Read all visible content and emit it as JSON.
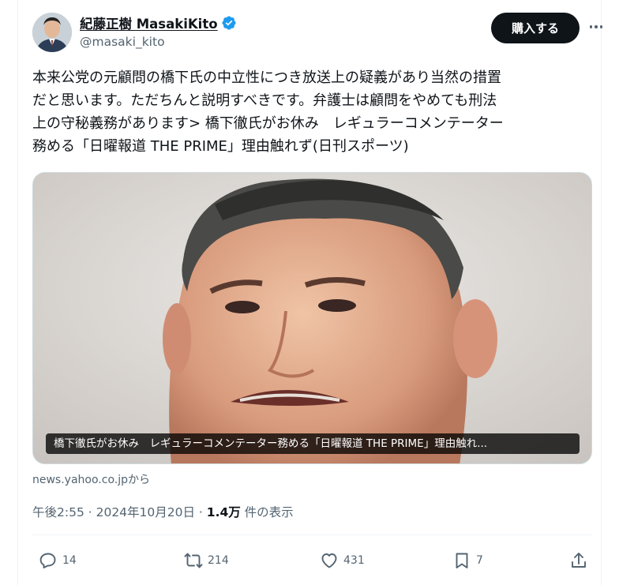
{
  "author": {
    "display_name": "紀藤正樹 MasakiKito",
    "handle": "@masaki_kito",
    "verified_color": "#1d9bf0"
  },
  "header": {
    "buy_button_label": "購入する",
    "more_icon": "more-horizontal-icon"
  },
  "tweet": {
    "text": "本来公党の元顧問の橋下氏の中立性につき放送上の疑義があり当然の措置\nだと思います。ただちんと説明すべきです。弁護士は顧問をやめても刑法\n上の守秘義務があります> 橋下徹氏がお休み　レギュラーコメンテーター\n務める「日曜報道 THE PRIME」理由触れず(日刊スポーツ)"
  },
  "media": {
    "caption": "橋下徹氏がお休み　レギュラーコメンテーター務める「日曜報道 THE PRIME」理由触れ...",
    "source": "news.yahoo.co.jpから"
  },
  "meta": {
    "time": "午後2:55",
    "separator": " · ",
    "date": "2024年10月20日",
    "views_count": "1.4万",
    "views_label": " 件の表示"
  },
  "actions": {
    "replies": "14",
    "reposts": "214",
    "likes": "431",
    "bookmarks": "7"
  }
}
